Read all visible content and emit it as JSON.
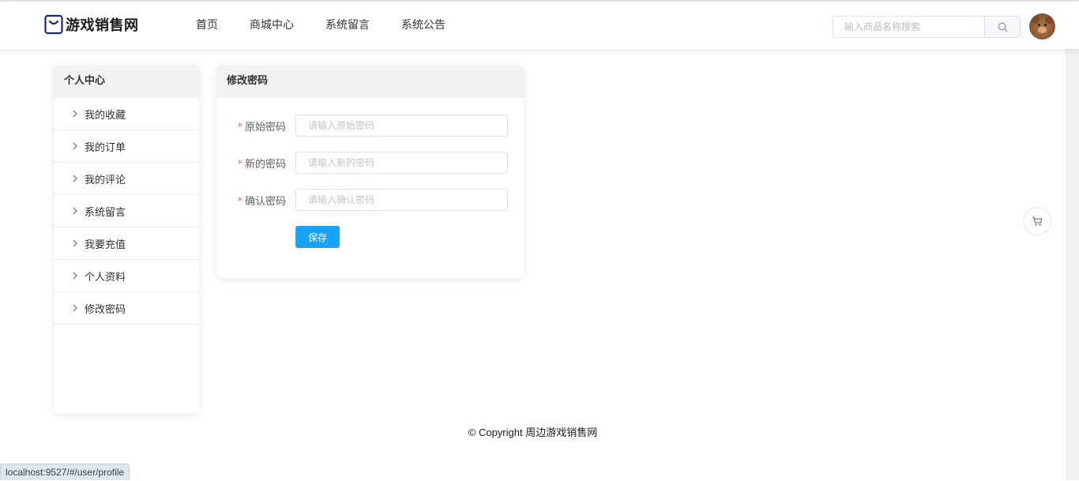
{
  "header": {
    "site_name": "游戏销售网",
    "nav": [
      "首页",
      "商城中心",
      "系统留言",
      "系统公告"
    ],
    "search_placeholder": "输入商品名称搜索"
  },
  "sidebar": {
    "title": "个人中心",
    "items": [
      "我的收藏",
      "我的订单",
      "我的评论",
      "系统留言",
      "我要充值",
      "个人资料",
      "修改密码"
    ]
  },
  "password_form": {
    "title": "修改密码",
    "fields": [
      {
        "label": "原始密码",
        "placeholder": "请输入原始密码",
        "value": ""
      },
      {
        "label": "新的密码",
        "placeholder": "请输入新的密码",
        "value": ""
      },
      {
        "label": "确认密码",
        "placeholder": "请输入确认密码",
        "value": ""
      }
    ],
    "required_mark": "*",
    "save_label": "保存"
  },
  "footer": {
    "copyright": "© Copyright 周边游戏销售网"
  },
  "status_url": "localhost:9527/#/user/profile",
  "colors": {
    "primary": "#1aa3f5",
    "required": "#f56c6c",
    "header_bg": "#ffffff",
    "card_head_bg": "#f2f2f2"
  }
}
